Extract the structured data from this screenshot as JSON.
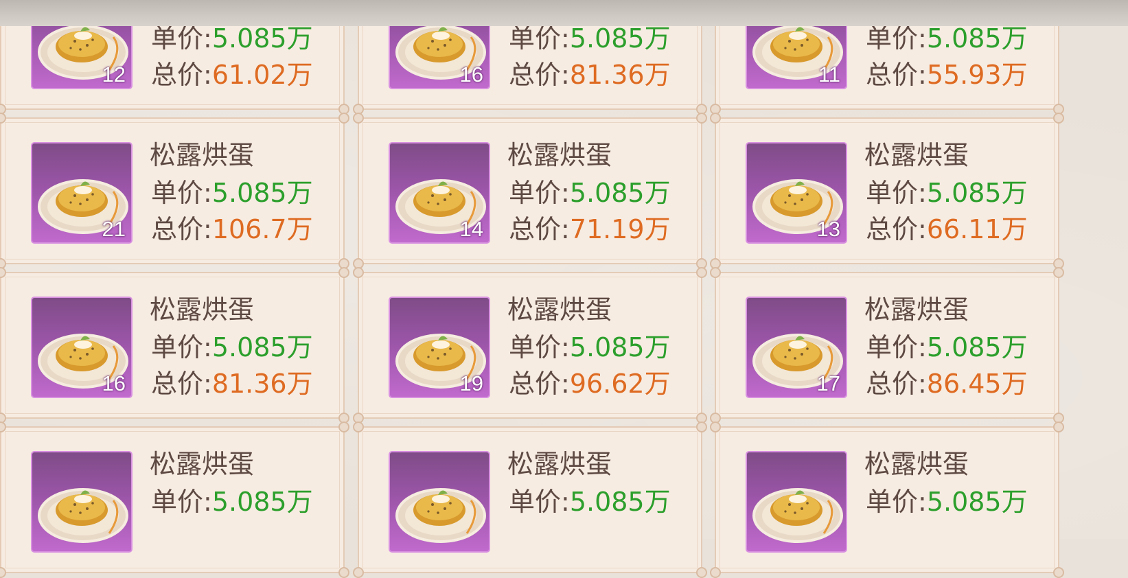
{
  "labels": {
    "item_name": "松露烘蛋",
    "unit_price": "单价:",
    "total_price": "总价:"
  },
  "colors": {
    "unit_price": "#2c9f2c",
    "total_price": "#de6b22",
    "icon_frame": "#c06acd"
  },
  "listings": [
    {
      "name": "",
      "qty": "12",
      "unit": "5.085万",
      "total": "61.02万"
    },
    {
      "name": "",
      "qty": "16",
      "unit": "5.085万",
      "total": "81.36万"
    },
    {
      "name": "",
      "qty": "11",
      "unit": "5.085万",
      "total": "55.93万"
    },
    {
      "name": "松露烘蛋",
      "qty": "21",
      "unit": "5.085万",
      "total": "106.7万"
    },
    {
      "name": "松露烘蛋",
      "qty": "14",
      "unit": "5.085万",
      "total": "71.19万"
    },
    {
      "name": "松露烘蛋",
      "qty": "13",
      "unit": "5.085万",
      "total": "66.11万"
    },
    {
      "name": "松露烘蛋",
      "qty": "16",
      "unit": "5.085万",
      "total": "81.36万"
    },
    {
      "name": "松露烘蛋",
      "qty": "19",
      "unit": "5.085万",
      "total": "96.62万"
    },
    {
      "name": "松露烘蛋",
      "qty": "17",
      "unit": "5.085万",
      "total": "86.45万"
    },
    {
      "name": "松露烘蛋",
      "qty": "",
      "unit": "5.085万",
      "total": ""
    },
    {
      "name": "松露烘蛋",
      "qty": "",
      "unit": "5.085万",
      "total": ""
    },
    {
      "name": "松露烘蛋",
      "qty": "",
      "unit": "5.085万",
      "total": ""
    }
  ],
  "item_icon": "truffle-omelette-plate-icon"
}
